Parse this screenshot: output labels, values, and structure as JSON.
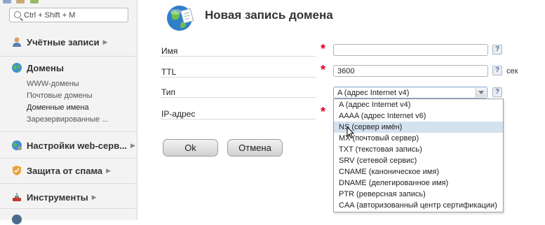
{
  "sidebar": {
    "search_placeholder": "Ctrl + Shift + M",
    "sections": {
      "accounts": "Учётные записи",
      "domains": "Домены",
      "web_settings": "Настройки web-серв...",
      "spam": "Защита от спама",
      "tools": "Инструменты"
    },
    "domain_items": [
      "WWW-домены",
      "Почтовые домены",
      "Доменные имена",
      "Зарезервированные ..."
    ]
  },
  "form": {
    "title": "Новая запись домена",
    "fields": {
      "name_label": "Имя",
      "name_value": "",
      "ttl_label": "TTL",
      "ttl_value": "3600",
      "ttl_unit": "сек",
      "type_label": "Тип",
      "type_selected": "A (адрес Internet v4)",
      "ip_label": "IP-адрес"
    },
    "required_mark": "*",
    "help_mark": "?",
    "type_options": [
      "A (адрес Internet v4)",
      "AAAA (адрес Internet v6)",
      "NS (сервер имён)",
      "MX (почтовый сервер)",
      "TXT (текстовая запись)",
      "SRV (сетевой сервис)",
      "CNAME (каноническое имя)",
      "DNAME (делегированное имя)",
      "PTR (реверсная запись)",
      "CAA (авторизованный центр сертификации)"
    ],
    "highlighted_option": "NS (сервер имён)",
    "buttons": {
      "ok": "Ok",
      "cancel": "Отмена"
    }
  },
  "colors": {
    "required": "#e2001a",
    "highlight": "#d4e1ee",
    "sidebar_bg": "#f3f3f3"
  }
}
